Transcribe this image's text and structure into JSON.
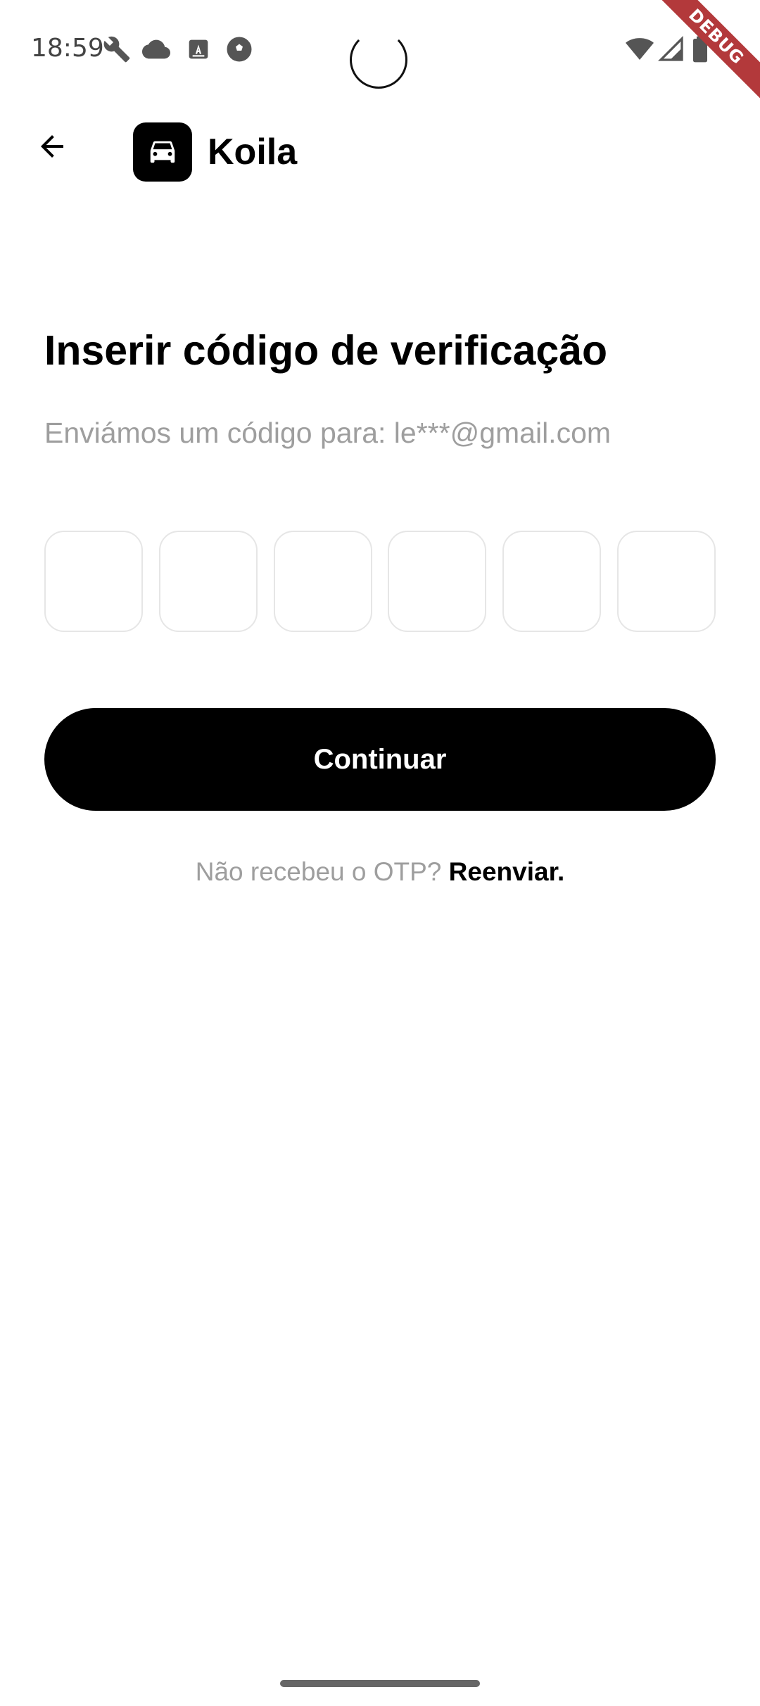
{
  "status_bar": {
    "time": "18:59",
    "icons": [
      "wrench-icon",
      "cloud-icon",
      "font-icon",
      "soccer-ball-icon",
      "wifi-icon",
      "signal-icon",
      "battery-icon"
    ],
    "debug_label": "DEBUG"
  },
  "app_bar": {
    "back_icon": "arrow-left-icon",
    "logo_icon": "car-icon",
    "brand_name": "Koila"
  },
  "content": {
    "title": "Inserir código de verificação",
    "subtitle": "Enviámos um código para: le***@gmail.com",
    "otp_digits": [
      "",
      "",
      "",
      "",
      "",
      ""
    ],
    "continue_label": "Continuar",
    "resend_prompt": "Não recebeu o OTP? ",
    "resend_link": "Reenviar."
  },
  "colors": {
    "primary": "#000000",
    "muted_text": "#9e9e9e",
    "input_border": "#e6e6e6",
    "debug_ribbon": "#b3393b"
  }
}
